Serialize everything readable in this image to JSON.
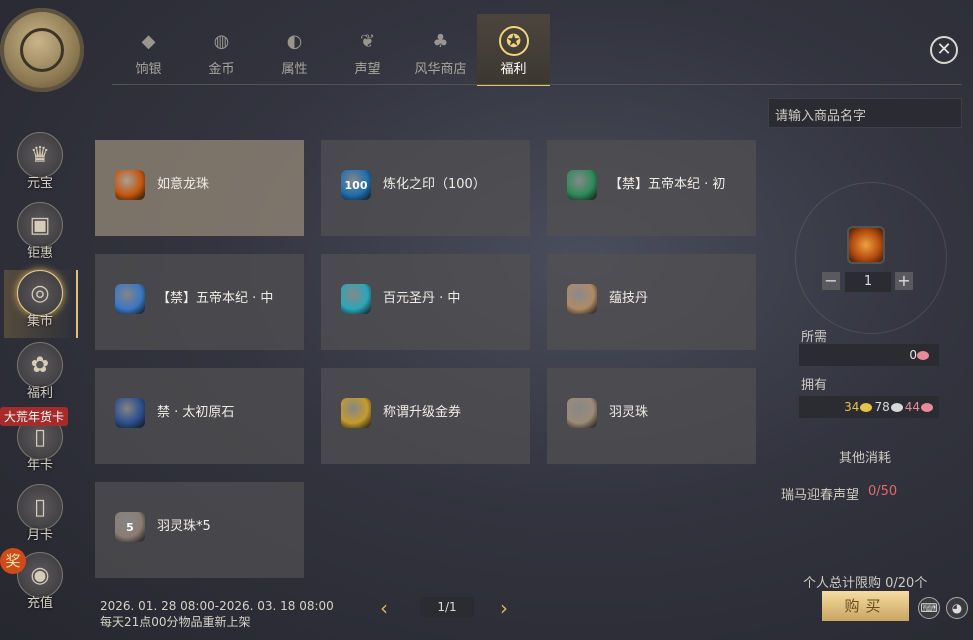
{
  "left_nav": {
    "items": [
      {
        "label": "元宝",
        "icon": "crown-icon",
        "glyph": "♛"
      },
      {
        "label": "钜惠",
        "icon": "gift-box-icon",
        "glyph": "▣"
      },
      {
        "label": "集市",
        "icon": "market-coin-icon",
        "glyph": "◎",
        "active": true
      },
      {
        "label": "福利",
        "icon": "money-bag-icon",
        "glyph": "✿"
      },
      {
        "label": "年卡",
        "icon": "year-card-icon",
        "glyph": "▯"
      },
      {
        "label": "月卡",
        "icon": "month-card-icon",
        "glyph": "▯"
      },
      {
        "label": "充值",
        "icon": "coin-stack-icon",
        "glyph": "◉"
      }
    ],
    "year_badge": "大荒年货卡",
    "reward_badge": "奖"
  },
  "tabs": [
    {
      "label": "饷银",
      "icon": "silver-ingot-icon",
      "glyph": "◆"
    },
    {
      "label": "金币",
      "icon": "gold-coin-icon",
      "glyph": "◍"
    },
    {
      "label": "属性",
      "icon": "attribute-icon",
      "glyph": "◐"
    },
    {
      "label": "声望",
      "icon": "reputation-icon",
      "glyph": "❦"
    },
    {
      "label": "风华商店",
      "icon": "elegance-shop-icon",
      "glyph": "♣"
    },
    {
      "label": "福利",
      "icon": "welfare-icon",
      "glyph": "✪",
      "active": true
    }
  ],
  "items": [
    {
      "name": "如意龙珠",
      "icon": "dragon-pearl-icon",
      "color": "#c5560f",
      "badge": "",
      "selected": true
    },
    {
      "name": "炼化之印（100）",
      "icon": "refine-seal-icon",
      "color": "#1f6fb0",
      "badge": "100"
    },
    {
      "name": "【禁】五帝本纪 · 初",
      "icon": "green-book-icon",
      "color": "#2e8a5a",
      "badge": ""
    },
    {
      "name": "【禁】五帝本纪 · 中",
      "icon": "blue-book-icon",
      "color": "#3a77c4",
      "badge": ""
    },
    {
      "name": "百元圣丹 · 中",
      "icon": "spirit-pill-icon",
      "color": "#2aa7b8",
      "badge": ""
    },
    {
      "name": "蕴技丹",
      "icon": "skill-pill-icon",
      "color": "#b08a66",
      "badge": ""
    },
    {
      "name": "禁 · 太初原石",
      "icon": "origin-stone-icon",
      "color": "#2c4f8c",
      "badge": ""
    },
    {
      "name": "称谓升级金券",
      "icon": "gold-ticket-icon",
      "color": "#c49b2e",
      "badge": ""
    },
    {
      "name": "羽灵珠",
      "icon": "feather-pearl-icon",
      "color": "#9c8c78",
      "badge": ""
    },
    {
      "name": "羽灵珠*5",
      "icon": "feather-pearl-bundle-icon",
      "color": "#8a7e74",
      "badge": "5"
    }
  ],
  "search": {
    "placeholder": "请输入商品名字"
  },
  "quantity": {
    "value": "1",
    "minus": "−",
    "plus": "+"
  },
  "cost": {
    "required_label": "所需",
    "required_value": "0",
    "owned_label": "拥有",
    "owned": [
      {
        "value": "34",
        "color": "#e5c24a"
      },
      {
        "value": "78",
        "color": "#d9d9d9"
      },
      {
        "value": "44",
        "color": "#e78a9a"
      }
    ],
    "required_coin_color": "#e78a9a"
  },
  "other_cost": {
    "title": "其他消耗",
    "name": "瑞马迎春声望",
    "value": "0/50"
  },
  "limit": "个人总计限购 0/20个",
  "buy_label": "购买",
  "footer": {
    "period": "2026. 01. 28 08:00-2026. 03. 18 08:00",
    "refresh": "每天21点00分物品重新上架"
  },
  "pager": {
    "page": "1/1",
    "prev": "‹",
    "next": "›"
  },
  "close": "✕"
}
